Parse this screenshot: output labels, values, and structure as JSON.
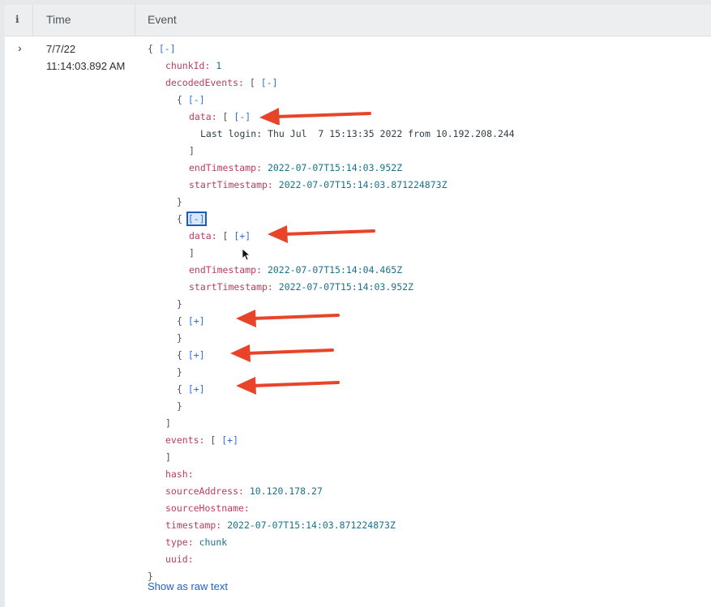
{
  "table": {
    "header": {
      "info_icon": "i",
      "time_col": "Time",
      "event_col": "Event"
    },
    "row": {
      "expand_icon": "chevron-right-icon",
      "expand_glyph": "›",
      "date": "7/7/22",
      "time": "11:14:03.892 AM"
    }
  },
  "event": {
    "root_toggle": "[-]",
    "chunkId_key": "chunkId:",
    "chunkId_val": "1",
    "decodedEvents_key": "decodedEvents:",
    "decodedEvents_toggle": "[-]",
    "items": [
      {
        "toggle": "[-]",
        "data_key": "data:",
        "data_toggle": "[-]",
        "data_line": "Last login: Thu Jul  7 15:13:35 2022 from 10.192.208.244",
        "endTimestamp_key": "endTimestamp:",
        "endTimestamp_val": "2022-07-07T15:14:03.952Z",
        "startTimestamp_key": "startTimestamp:",
        "startTimestamp_val": "2022-07-07T15:14:03.871224873Z"
      },
      {
        "toggle": "[-]",
        "data_key": "data:",
        "data_toggle": "[+]",
        "endTimestamp_key": "endTimestamp:",
        "endTimestamp_val": "2022-07-07T15:14:04.465Z",
        "startTimestamp_key": "startTimestamp:",
        "startTimestamp_val": "2022-07-07T15:14:03.952Z"
      },
      {
        "toggle": "[+]"
      },
      {
        "toggle": "[+]"
      },
      {
        "toggle": "[+]"
      }
    ],
    "events_key": "events:",
    "events_toggle": "[+]",
    "hash_key": "hash:",
    "sourceAddress_key": "sourceAddress:",
    "sourceAddress_val": "10.120.178.27",
    "sourceHostname_key": "sourceHostname:",
    "timestamp_key": "timestamp:",
    "timestamp_val": "2022-07-07T15:14:03.871224873Z",
    "type_key": "type:",
    "type_val": "chunk",
    "uuid_key": "uuid:",
    "show_raw": "Show as raw text"
  },
  "annotations": {
    "arrow_color": "#e8442a",
    "arrow_count": 5
  },
  "colors": {
    "key": "#b93e5e",
    "value": "#17728a",
    "toggle": "#2f6fd8",
    "link": "#1a63c5"
  }
}
